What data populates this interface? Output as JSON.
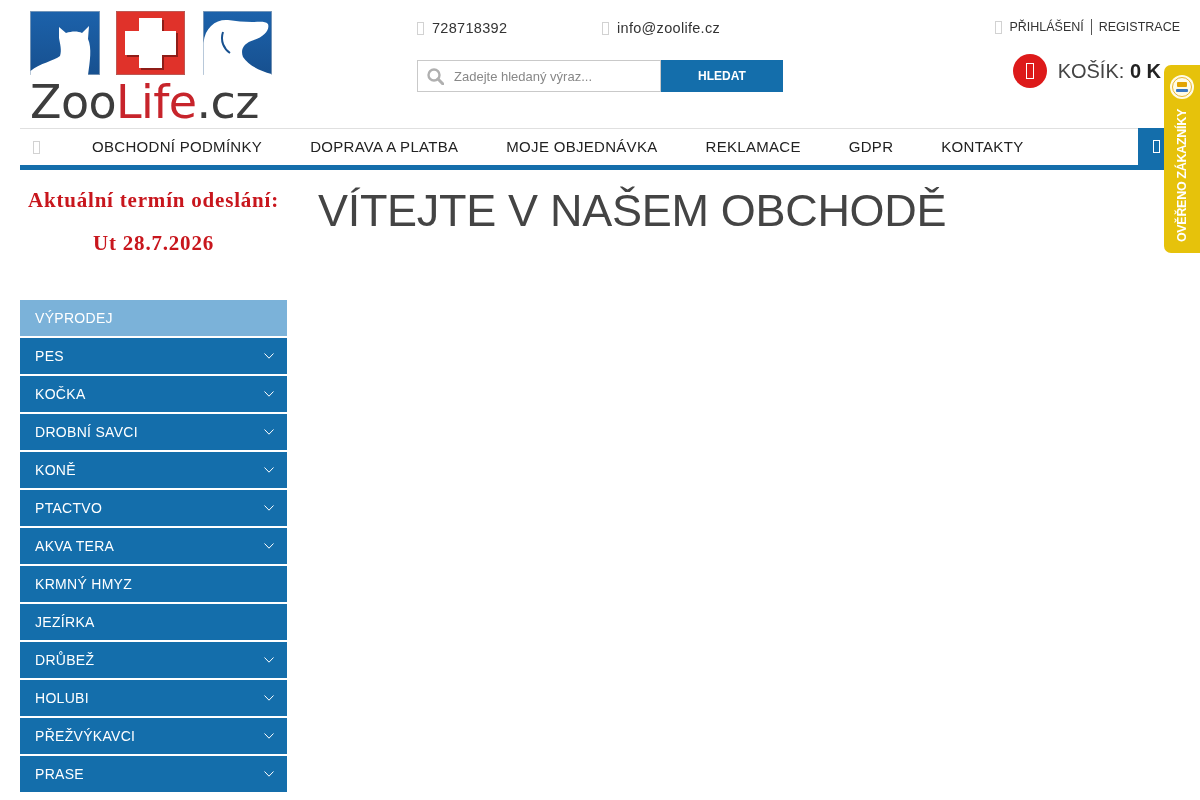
{
  "logo": {
    "parts": [
      {
        "text": "Zoo",
        "accent": false
      },
      {
        "text": "Life",
        "accent": true
      },
      {
        "text": ".cz",
        "accent": false
      }
    ]
  },
  "contacts": [
    "728718392",
    "info@zoolife.cz"
  ],
  "account_links": [
    "PŘIHLÁŠENÍ",
    "REGISTRACE"
  ],
  "search": {
    "placeholder": "Zadejte hledaný výraz...",
    "button": "HLEDAT"
  },
  "cart": {
    "label": "KOŠÍK: **0 K**"
  },
  "nav": {
    "items": [
      "OBCHODNÍ PODMÍNKY",
      "DOPRAVA A PLATBA",
      "MOJE OBJEDNÁVKA",
      "REKLAMACE",
      "GDPR",
      "KONTAKTY"
    ]
  },
  "verified_badge": {
    "text": "OVĚŘENO ZÁKAZNÍKY"
  },
  "shipping_notice": {
    "lines": [
      "Aktuální termín odeslání:",
      "Ut 28.7.2026"
    ]
  },
  "categories": [
    {
      "label": "VÝPRODEJ",
      "selected": true,
      "expandable": false
    },
    {
      "label": "PES",
      "selected": false,
      "expandable": true
    },
    {
      "label": "KOČKA",
      "selected": false,
      "expandable": true
    },
    {
      "label": "DROBNÍ SAVCI",
      "selected": false,
      "expandable": true
    },
    {
      "label": "KONĚ",
      "selected": false,
      "expandable": true
    },
    {
      "label": "PTACTVO",
      "selected": false,
      "expandable": true
    },
    {
      "label": "AKVA TERA",
      "selected": false,
      "expandable": true
    },
    {
      "label": "KRMNÝ HMYZ",
      "selected": false,
      "expandable": false
    },
    {
      "label": "JEZÍRKA",
      "selected": false,
      "expandable": false
    },
    {
      "label": "DRŮBEŽ",
      "selected": false,
      "expandable": true
    },
    {
      "label": "HOLUBI",
      "selected": false,
      "expandable": true
    },
    {
      "label": "PŘEŽVÝKAVCI",
      "selected": false,
      "expandable": true
    },
    {
      "label": "PRASE",
      "selected": false,
      "expandable": true
    }
  ],
  "heading": "VÍTEJTE V NAŠEM OBCHODĚ"
}
